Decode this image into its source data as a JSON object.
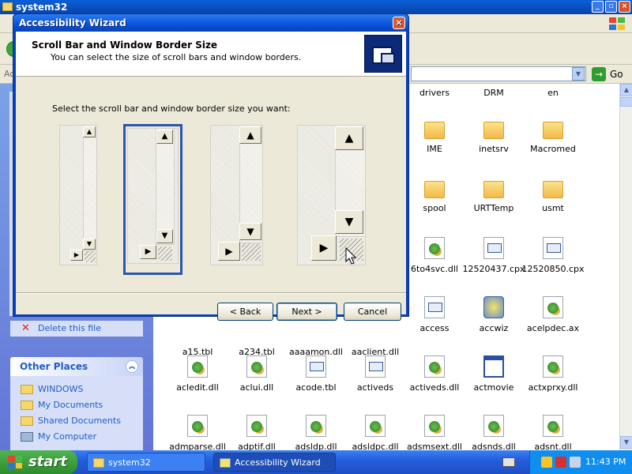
{
  "explorer": {
    "title": "system32",
    "address_label": "Ac",
    "go_label": "Go",
    "left_pane": {
      "file_tasks": [
        {
          "label": "Delete this file",
          "icon": "delete-icon"
        }
      ],
      "other_places": {
        "title": "Other Places",
        "items": [
          {
            "label": "WINDOWS",
            "icon": "folder-icon"
          },
          {
            "label": "My Documents",
            "icon": "folder-icon"
          },
          {
            "label": "Shared Documents",
            "icon": "folder-icon"
          },
          {
            "label": "My Computer",
            "icon": "computer-icon"
          }
        ]
      }
    },
    "files": [
      {
        "name": "drivers",
        "type": "folder"
      },
      {
        "name": "DRM",
        "type": "folder"
      },
      {
        "name": "en",
        "type": "folder"
      },
      {
        "name": "IME",
        "type": "folder"
      },
      {
        "name": "inetsrv",
        "type": "folder"
      },
      {
        "name": "Macromed",
        "type": "folder"
      },
      {
        "name": "spool",
        "type": "folder"
      },
      {
        "name": "URTTemp",
        "type": "folder"
      },
      {
        "name": "usmt",
        "type": "folder"
      },
      {
        "name": "6to4svc.dll",
        "type": "dll"
      },
      {
        "name": "12520437.cpx",
        "type": "doc"
      },
      {
        "name": "12520850.cpx",
        "type": "doc"
      },
      {
        "name": "a15.tbl",
        "type": "doc"
      },
      {
        "name": "a234.tbl",
        "type": "doc"
      },
      {
        "name": "aaaamon.dll",
        "type": "dll"
      },
      {
        "name": "aaclient.dll",
        "type": "dll"
      },
      {
        "name": "access",
        "type": "doc"
      },
      {
        "name": "accwiz",
        "type": "wiz"
      },
      {
        "name": "acelpdec.ax",
        "type": "dll"
      },
      {
        "name": "acledit.dll",
        "type": "dll"
      },
      {
        "name": "aclui.dll",
        "type": "dll"
      },
      {
        "name": "acode.tbl",
        "type": "doc"
      },
      {
        "name": "activeds",
        "type": "doc"
      },
      {
        "name": "activeds.dll",
        "type": "dll"
      },
      {
        "name": "actmovie",
        "type": "app"
      },
      {
        "name": "actxprxy.dll",
        "type": "dll"
      },
      {
        "name": "admparse.dll",
        "type": "dll"
      },
      {
        "name": "adptif.dll",
        "type": "dll"
      },
      {
        "name": "adsldp.dll",
        "type": "dll"
      },
      {
        "name": "adsldpc.dll",
        "type": "dll"
      },
      {
        "name": "adsmsext.dll",
        "type": "dll"
      },
      {
        "name": "adsnds.dll",
        "type": "dll"
      },
      {
        "name": "adsnt.dll",
        "type": "dll"
      }
    ]
  },
  "dialog": {
    "title": "Accessibility Wizard",
    "heading": "Scroll Bar and Window Border Size",
    "subheading": "You can select the size of scroll bars and window borders.",
    "prompt": "Select the scroll bar and window border size you want:",
    "selected_option": 2,
    "buttons": {
      "back": "< Back",
      "next": "Next >",
      "cancel": "Cancel"
    }
  },
  "taskbar": {
    "start": "start",
    "tasks": [
      {
        "label": "system32",
        "active": false
      },
      {
        "label": "Accessibility Wizard",
        "active": true
      }
    ],
    "clock": "11:43 PM"
  },
  "colors": {
    "xp_blue": "#0a52d8",
    "start_green": "#2e8b2e",
    "selection_blue": "#2a55b0"
  }
}
